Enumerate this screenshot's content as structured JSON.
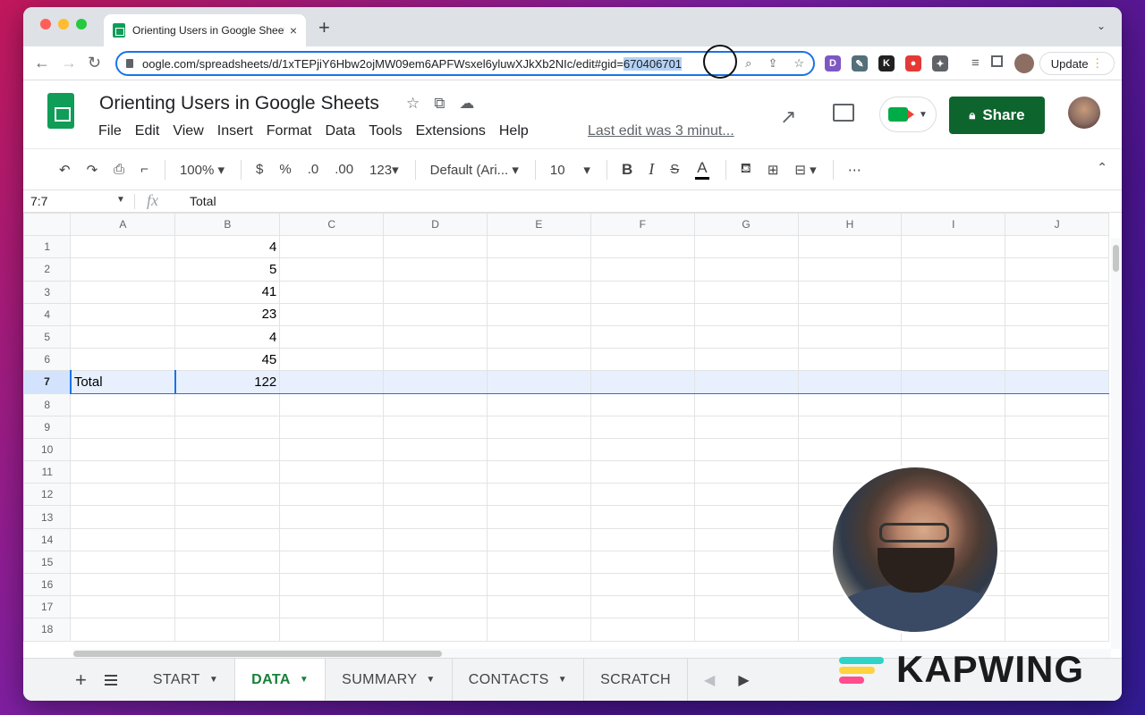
{
  "browser": {
    "tab_title": "Orienting Users in Google Sheets",
    "new_tab_icon": "+",
    "close_icon": "×",
    "url_prefix": "oogle.com/spreadsheets/d/1xTEPjiY6Hbw2ojMW09em6APFWsxel6yluwXJkXb2NIc/edit#gid=",
    "url_selected": "670406701",
    "update_label": "Update",
    "extensions": [
      {
        "label": "D",
        "color": "#7e57c2"
      },
      {
        "label": "✎",
        "color": "#546e7a"
      },
      {
        "label": "K",
        "color": "#212121"
      },
      {
        "label": "●",
        "color": "#e53935"
      },
      {
        "label": "✦",
        "color": "#5f6368"
      }
    ]
  },
  "sheets": {
    "title": "Orienting Users in Google Sheets",
    "menu": [
      "File",
      "Edit",
      "View",
      "Insert",
      "Format",
      "Data",
      "Tools",
      "Extensions",
      "Help"
    ],
    "last_edit": "Last edit was 3 minut...",
    "share_label": "Share",
    "brand_color": "#0d652d"
  },
  "toolbar": {
    "zoom": "100%",
    "currency": "$",
    "percent": "%",
    "dec_less": ".0",
    "dec_more": ".00",
    "more_formats": "123",
    "font": "Default (Ari...",
    "font_size": "10",
    "bold": "B",
    "italic": "I",
    "strike": "S",
    "text_color": "A",
    "more": "⋯"
  },
  "formula_bar": {
    "name_box": "7:7",
    "fx": "fx",
    "value": "Total"
  },
  "grid": {
    "columns": [
      "A",
      "B",
      "C",
      "D",
      "E",
      "F",
      "G",
      "H",
      "I",
      "J"
    ],
    "rows": [
      {
        "n": "1",
        "a": "",
        "b": "4"
      },
      {
        "n": "2",
        "a": "",
        "b": "5"
      },
      {
        "n": "3",
        "a": "",
        "b": "41"
      },
      {
        "n": "4",
        "a": "",
        "b": "23"
      },
      {
        "n": "5",
        "a": "",
        "b": "4"
      },
      {
        "n": "6",
        "a": "",
        "b": "45"
      },
      {
        "n": "7",
        "a": "Total",
        "b": "122"
      },
      {
        "n": "8",
        "a": "",
        "b": ""
      },
      {
        "n": "9",
        "a": "",
        "b": ""
      },
      {
        "n": "10",
        "a": "",
        "b": ""
      },
      {
        "n": "11",
        "a": "",
        "b": ""
      },
      {
        "n": "12",
        "a": "",
        "b": ""
      },
      {
        "n": "13",
        "a": "",
        "b": ""
      },
      {
        "n": "14",
        "a": "",
        "b": ""
      },
      {
        "n": "15",
        "a": "",
        "b": ""
      },
      {
        "n": "16",
        "a": "",
        "b": ""
      },
      {
        "n": "17",
        "a": "",
        "b": ""
      },
      {
        "n": "18",
        "a": "",
        "b": ""
      }
    ],
    "selected_row": "7"
  },
  "sheet_tabs": [
    {
      "label": "START",
      "active": false
    },
    {
      "label": "DATA",
      "active": true
    },
    {
      "label": "SUMMARY",
      "active": false
    },
    {
      "label": "CONTACTS",
      "active": false
    },
    {
      "label": "SCRATCH",
      "active": false
    }
  ],
  "watermark": {
    "text": "KAPWING"
  }
}
